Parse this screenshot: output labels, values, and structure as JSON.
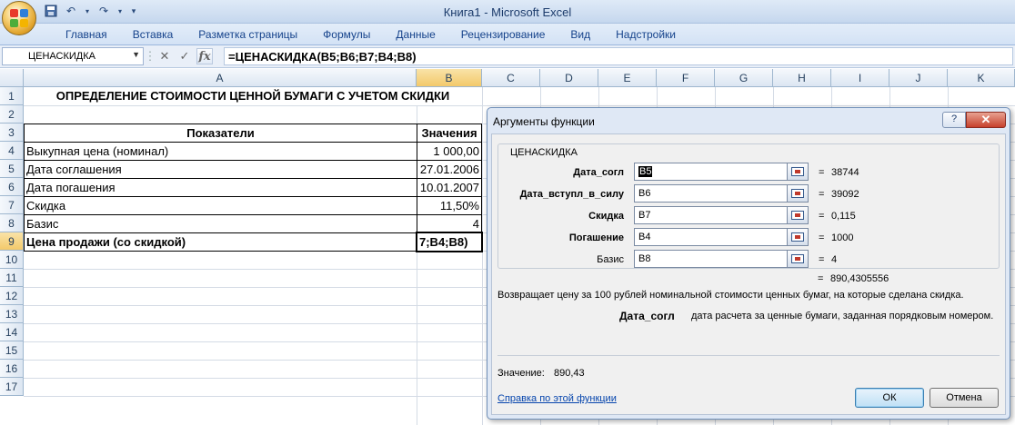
{
  "window": {
    "title": "Книга1 - Microsoft Excel"
  },
  "ribbon": {
    "tabs": [
      "Главная",
      "Вставка",
      "Разметка страницы",
      "Формулы",
      "Данные",
      "Рецензирование",
      "Вид",
      "Надстройки"
    ]
  },
  "formula_bar": {
    "name_box": "ЦЕНАСКИДКА",
    "formula": "=ЦЕНАСКИДКА(B5;B6;B7;B4;B8)"
  },
  "grid": {
    "columns": [
      "A",
      "B",
      "C",
      "D",
      "E",
      "F",
      "G",
      "H",
      "I",
      "J",
      "K"
    ],
    "rows": [
      "1",
      "2",
      "3",
      "4",
      "5",
      "6",
      "7",
      "8",
      "9",
      "10",
      "11",
      "12",
      "13",
      "14",
      "15",
      "16",
      "17"
    ],
    "title": "ОПРЕДЕЛЕНИЕ СТОИМОСТИ ЦЕННОЙ БУМАГИ С УЧЕТОМ СКИДКИ",
    "header_a": "Показатели",
    "header_b": "Значения",
    "table": [
      {
        "label": "Выкупная цена (номинал)",
        "value": "1 000,00"
      },
      {
        "label": "Дата соглашения",
        "value": "27.01.2006"
      },
      {
        "label": "Дата погашения",
        "value": "10.01.2007"
      },
      {
        "label": "Скидка",
        "value": "11,50%"
      },
      {
        "label": "Базис",
        "value": "4"
      },
      {
        "label": "Цена продажи (со скидкой)",
        "value": "7;B4;B8)"
      }
    ]
  },
  "dialog": {
    "title": "Аргументы функции",
    "help_glyph": "?",
    "close_glyph": "✕",
    "function_name": "ЦЕНАСКИДКА",
    "args": [
      {
        "label": "Дата_согл",
        "ref_selected": "B5",
        "result": "38744",
        "bold": true
      },
      {
        "label": "Дата_вступл_в_силу",
        "ref": "B6",
        "result": "39092",
        "bold": true
      },
      {
        "label": "Скидка",
        "ref": "B7",
        "result": "0,115",
        "bold": true
      },
      {
        "label": "Погашение",
        "ref": "B4",
        "result": "1000",
        "bold": true
      },
      {
        "label": "Базис",
        "ref": "B8",
        "result": "4",
        "bold": false
      }
    ],
    "eq": "=",
    "total_result": "890,4305556",
    "description": "Возвращает цену за 100 рублей номинальной стоимости ценных бумаг, на которые сделана скидка.",
    "arg_help_name": "Дата_согл",
    "arg_help_text": "дата расчета за ценные бумаги, заданная порядковым номером.",
    "value_label": "Значение:",
    "value": "890,43",
    "help_link": "Справка по этой функции",
    "ok": "ОК",
    "cancel": "Отмена"
  },
  "colors": {
    "office_logo": [
      "#e8392b",
      "#2f7fd8",
      "#4cad3b",
      "#f4b400"
    ]
  }
}
